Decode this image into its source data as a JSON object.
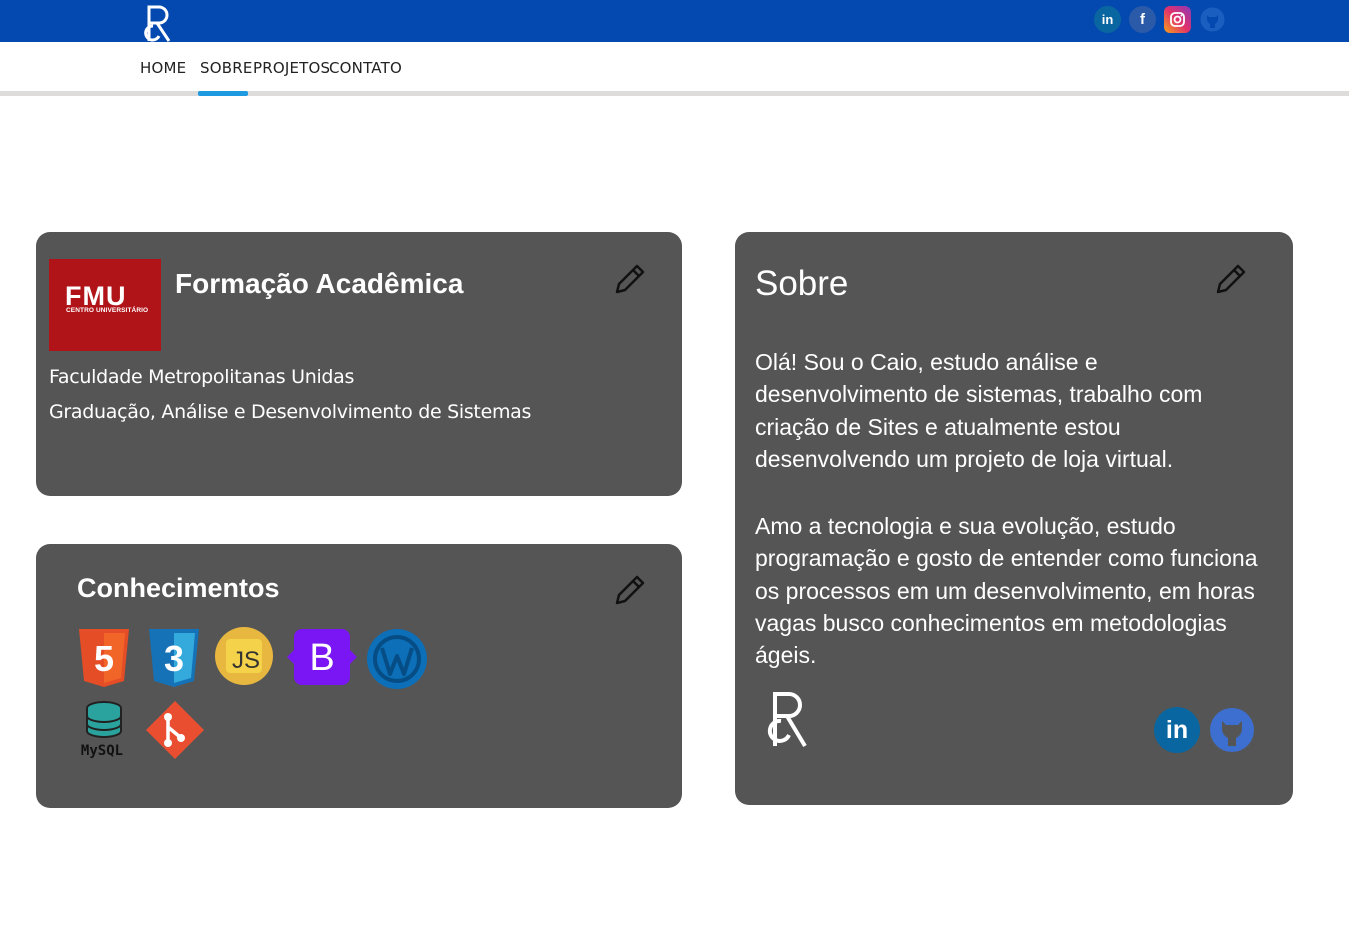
{
  "header": {
    "logo_icon": "rc-monogram-logo",
    "social": [
      "linkedin-icon",
      "facebook-icon",
      "instagram-icon",
      "github-icon"
    ],
    "brand_color": "#0449b0"
  },
  "nav": {
    "items": [
      "HOME",
      "SOBRE",
      "PROJETOS",
      "CONTATO"
    ],
    "active": "SOBRE",
    "accent": "#1e9be0"
  },
  "formacao": {
    "title": "Formação Acadêmica",
    "logo_text": "FMU",
    "logo_sub": "CENTRO UNIVERSITÁRIO",
    "institution": "Faculdade Metropolitanas Unidas",
    "course": "Graduação, Análise e Desenvolvimento de Sistemas"
  },
  "conhecimentos": {
    "title": "Conhecimentos",
    "icons": [
      "html5-icon",
      "css3-icon",
      "javascript-icon",
      "bootstrap-icon",
      "wordpress-icon",
      "mysql-icon",
      "git-icon"
    ],
    "mysql_label": "MySQL",
    "bootstrap_label": "B",
    "html_label": "5",
    "css_label": "3",
    "js_label": "JS",
    "fb_label": "f",
    "li_label": "in"
  },
  "sobre": {
    "title": "Sobre",
    "paragraph1": "Olá! Sou o Caio, estudo análise e desenvolvimento de sistemas, trabalho com criação de Sites e atualmente estou desenvolvendo um projeto de loja virtual.",
    "paragraph2": "Amo a tecnologia e sua evolução, estudo programação e gosto de entender como funciona os processos em um desenvolvimento, em horas vagas busco conhecimentos em metodologias ágeis."
  },
  "card_color": "#555555"
}
